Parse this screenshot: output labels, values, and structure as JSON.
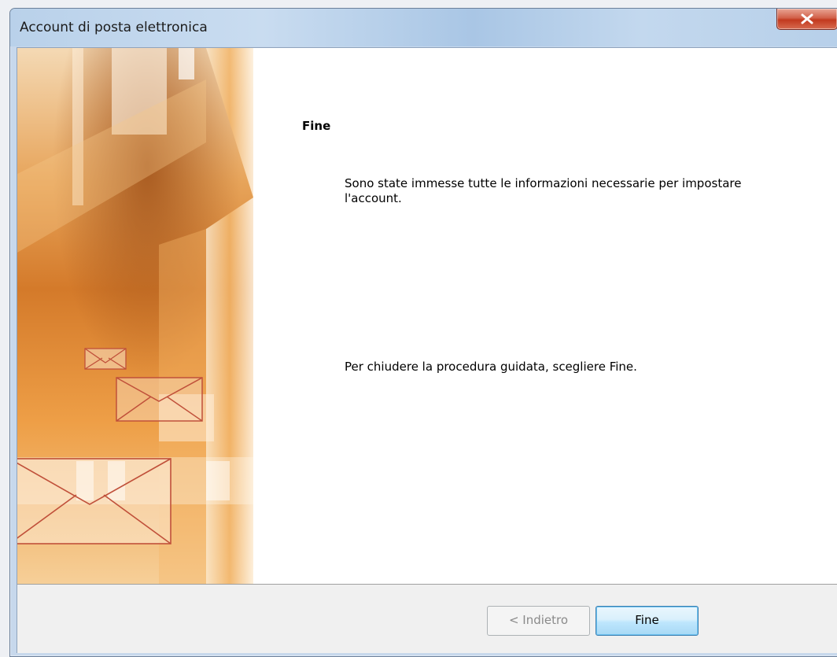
{
  "window": {
    "title": "Account di posta elettronica",
    "close_label": "x"
  },
  "wizard": {
    "heading": "Fine",
    "message": "Sono state immesse tutte le informazioni necessarie per impostare l'account.",
    "instruction": "Per chiudere la procedura guidata, scegliere Fine."
  },
  "buttons": {
    "back_label": "< Indietro",
    "back_enabled": false,
    "finish_label": "Fine"
  },
  "colors": {
    "banner_accent": "#e89a3c",
    "banner_dark": "#b7651f",
    "envelope_stroke": "#c0503a",
    "titlebar": "#c3d8ee",
    "close_button": "#c9482c",
    "default_button_border": "#3c7fb1"
  }
}
